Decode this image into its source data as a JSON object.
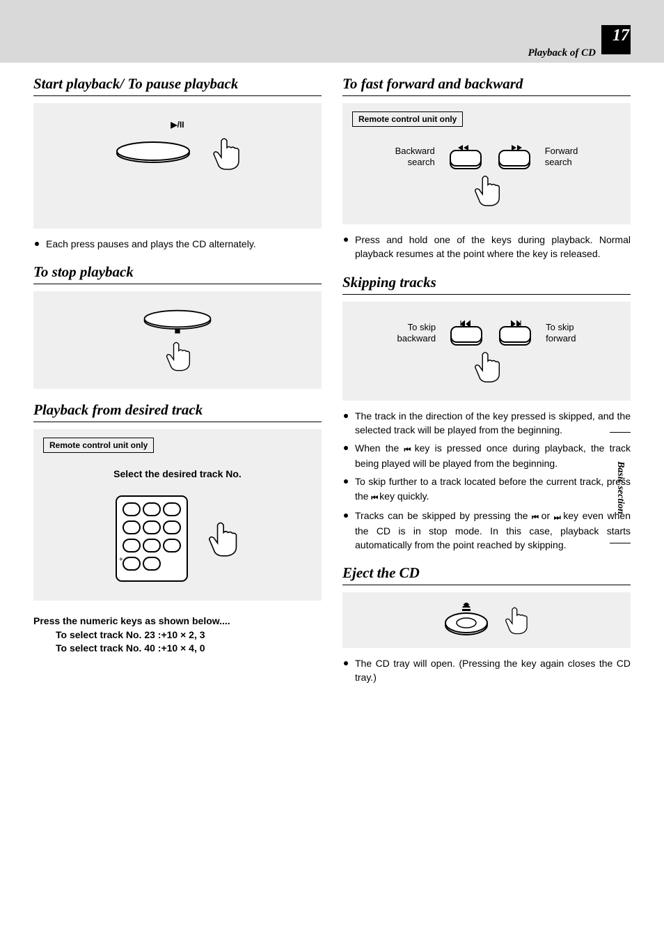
{
  "page": {
    "number": "17",
    "breadcrumb": "Playback of CD",
    "side_tab": "Basic section"
  },
  "left": {
    "s1": {
      "heading": "Start playback/ To pause playback",
      "icon_label": "▶/II",
      "bullet1": "Each press pauses and plays the CD alternately."
    },
    "s2": {
      "heading": "To stop playback"
    },
    "s3": {
      "heading": "Playback from desired track",
      "note": "Remote control unit only",
      "select_label": "Select the desired track No.",
      "instr_lead": "Press the numeric keys as shown below....",
      "instr_l1": "To select track No. 23 :+10 × 2, 3",
      "instr_l2": "To select track No. 40 :+10 × 4, 0"
    }
  },
  "right": {
    "s1": {
      "heading": "To fast forward and backward",
      "note": "Remote control unit only",
      "left_l1": "Backward",
      "left_l2": "search",
      "right_l1": "Forward",
      "right_l2": "search",
      "bullet1": "Press and hold one of the keys during playback. Normal playback resumes at the point where the key is released."
    },
    "s2": {
      "heading": "Skipping tracks",
      "left_l1": "To skip",
      "left_l2": "backward",
      "right_l1": "To skip",
      "right_l2": "forward",
      "bullet1": "The track in the direction of the key pressed  is skipped, and the selected track will be played from the beginning.",
      "bullet2_a": "When the ",
      "bullet2_b": " key is pressed once during playback, the  track being played will be played from the beginning.",
      "bullet3_a": "To skip further to a track located before the current track, press the ",
      "bullet3_b": " key quickly.",
      "bullet4_a": "Tracks can be skipped by pressing the ",
      "bullet4_b": " or ",
      "bullet4_c": " key even when the CD is in stop mode. In this case, playback starts automatically from the point reached by skipping."
    },
    "s3": {
      "heading": "Eject the CD",
      "bullet1": "The CD tray will open. (Pressing the key again closes the CD tray.)"
    }
  }
}
